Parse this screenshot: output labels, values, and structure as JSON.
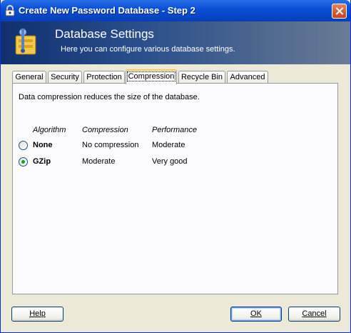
{
  "window": {
    "title": "Create New Password Database - Step 2",
    "close_icon": "close-icon"
  },
  "banner": {
    "title": "Database Settings",
    "subtitle": "Here you can configure various database settings.",
    "icon": "database-settings-icon"
  },
  "tabs": [
    {
      "label": "General",
      "active": false
    },
    {
      "label": "Security",
      "active": false
    },
    {
      "label": "Protection",
      "active": false
    },
    {
      "label": "Compression",
      "active": true
    },
    {
      "label": "Recycle Bin",
      "active": false
    },
    {
      "label": "Advanced",
      "active": false
    }
  ],
  "compression": {
    "description": "Data compression reduces the size of the database.",
    "headers": {
      "algorithm": "Algorithm",
      "compression": "Compression",
      "performance": "Performance"
    },
    "options": [
      {
        "algorithm": "None",
        "compression": "No compression",
        "performance": "Moderate",
        "selected": false
      },
      {
        "algorithm": "GZip",
        "compression": "Moderate",
        "performance": "Very good",
        "selected": true
      }
    ]
  },
  "buttons": {
    "help": {
      "label": "Help",
      "mnemonic": "H"
    },
    "ok": {
      "label": "OK",
      "mnemonic": "O"
    },
    "cancel": {
      "label": "Cancel",
      "mnemonic": "C"
    }
  },
  "colors": {
    "titlebar": "#0a50d8",
    "face": "#ece9d8",
    "tab_highlight": "#ffc83c",
    "radio_dot": "#21a121"
  }
}
